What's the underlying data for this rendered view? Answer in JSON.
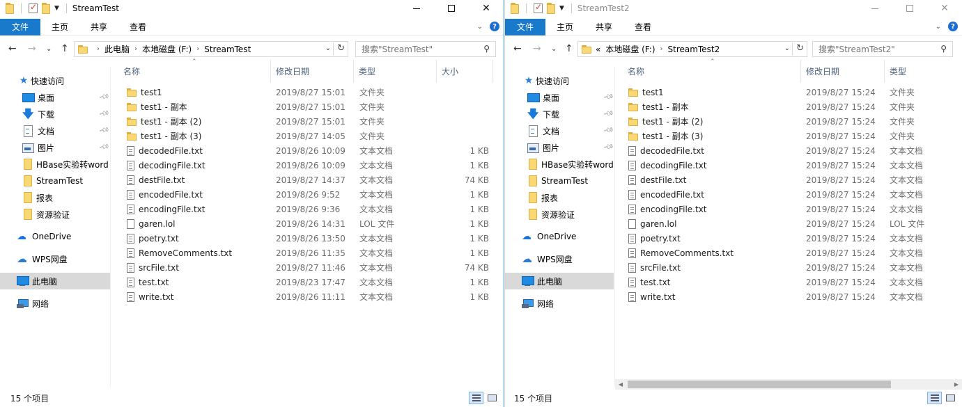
{
  "windows": [
    {
      "title": "StreamTest",
      "ribbon_tabs": [
        "文件",
        "主页",
        "共享",
        "查看"
      ],
      "breadcrumb": [
        "此电脑",
        "本地磁盘 (F:)",
        "StreamTest"
      ],
      "breadcrumb_prefix": "",
      "search_placeholder": "搜索\"StreamTest\"",
      "columns": [
        "名称",
        "修改日期",
        "类型",
        "大小"
      ],
      "status": "15 个项目",
      "files": [
        {
          "name": "test1",
          "date": "2019/8/27 15:01",
          "type": "文件夹",
          "size": "",
          "kind": "folder"
        },
        {
          "name": "test1 - 副本",
          "date": "2019/8/27 15:01",
          "type": "文件夹",
          "size": "",
          "kind": "folder"
        },
        {
          "name": "test1 - 副本 (2)",
          "date": "2019/8/27 15:01",
          "type": "文件夹",
          "size": "",
          "kind": "folder"
        },
        {
          "name": "test1 - 副本 (3)",
          "date": "2019/8/27 14:05",
          "type": "文件夹",
          "size": "",
          "kind": "folder"
        },
        {
          "name": "decodedFile.txt",
          "date": "2019/8/26 10:09",
          "type": "文本文档",
          "size": "1 KB",
          "kind": "txt"
        },
        {
          "name": "decodingFile.txt",
          "date": "2019/8/26 10:09",
          "type": "文本文档",
          "size": "1 KB",
          "kind": "txt"
        },
        {
          "name": "destFile.txt",
          "date": "2019/8/27 14:37",
          "type": "文本文档",
          "size": "74 KB",
          "kind": "txt"
        },
        {
          "name": "encodedFile.txt",
          "date": "2019/8/26 9:52",
          "type": "文本文档",
          "size": "1 KB",
          "kind": "txt"
        },
        {
          "name": "encodingFile.txt",
          "date": "2019/8/26 9:36",
          "type": "文本文档",
          "size": "1 KB",
          "kind": "txt"
        },
        {
          "name": "garen.lol",
          "date": "2019/8/26 14:31",
          "type": "LOL 文件",
          "size": "1 KB",
          "kind": "file"
        },
        {
          "name": "poetry.txt",
          "date": "2019/8/26 13:50",
          "type": "文本文档",
          "size": "1 KB",
          "kind": "txt"
        },
        {
          "name": "RemoveComments.txt",
          "date": "2019/8/26 11:35",
          "type": "文本文档",
          "size": "1 KB",
          "kind": "txt"
        },
        {
          "name": "srcFile.txt",
          "date": "2019/8/27 11:46",
          "type": "文本文档",
          "size": "74 KB",
          "kind": "txt"
        },
        {
          "name": "test.txt",
          "date": "2019/8/23 17:47",
          "type": "文本文档",
          "size": "1 KB",
          "kind": "txt"
        },
        {
          "name": "write.txt",
          "date": "2019/8/26 11:11",
          "type": "文本文档",
          "size": "1 KB",
          "kind": "txt"
        }
      ]
    },
    {
      "title": "StreamTest2",
      "ribbon_tabs": [
        "文件",
        "主页",
        "共享",
        "查看"
      ],
      "breadcrumb": [
        "本地磁盘 (F:)",
        "StreamTest2"
      ],
      "breadcrumb_prefix": "«",
      "search_placeholder": "搜索\"StreamTest2\"",
      "columns": [
        "名称",
        "修改日期",
        "类型"
      ],
      "status": "15 个项目",
      "files": [
        {
          "name": "test1",
          "date": "2019/8/27 15:24",
          "type": "文件夹",
          "kind": "folder"
        },
        {
          "name": "test1 - 副本",
          "date": "2019/8/27 15:24",
          "type": "文件夹",
          "kind": "folder"
        },
        {
          "name": "test1 - 副本 (2)",
          "date": "2019/8/27 15:24",
          "type": "文件夹",
          "kind": "folder"
        },
        {
          "name": "test1 - 副本 (3)",
          "date": "2019/8/27 15:24",
          "type": "文件夹",
          "kind": "folder"
        },
        {
          "name": "decodedFile.txt",
          "date": "2019/8/27 15:24",
          "type": "文本文档",
          "kind": "txt"
        },
        {
          "name": "decodingFile.txt",
          "date": "2019/8/27 15:24",
          "type": "文本文档",
          "kind": "txt"
        },
        {
          "name": "destFile.txt",
          "date": "2019/8/27 15:24",
          "type": "文本文档",
          "kind": "txt"
        },
        {
          "name": "encodedFile.txt",
          "date": "2019/8/27 15:24",
          "type": "文本文档",
          "kind": "txt"
        },
        {
          "name": "encodingFile.txt",
          "date": "2019/8/27 15:24",
          "type": "文本文档",
          "kind": "txt"
        },
        {
          "name": "garen.lol",
          "date": "2019/8/27 15:24",
          "type": "LOL 文件",
          "kind": "file"
        },
        {
          "name": "poetry.txt",
          "date": "2019/8/27 15:24",
          "type": "文本文档",
          "kind": "txt"
        },
        {
          "name": "RemoveComments.txt",
          "date": "2019/8/27 15:24",
          "type": "文本文档",
          "kind": "txt"
        },
        {
          "name": "srcFile.txt",
          "date": "2019/8/27 15:24",
          "type": "文本文档",
          "kind": "txt"
        },
        {
          "name": "test.txt",
          "date": "2019/8/27 15:24",
          "type": "文本文档",
          "kind": "txt"
        },
        {
          "name": "write.txt",
          "date": "2019/8/27 15:24",
          "type": "文本文档",
          "kind": "txt"
        }
      ]
    }
  ],
  "nav": {
    "quick_access": "快速访问",
    "items": [
      {
        "label": "桌面",
        "icon": "desktop-icon",
        "pinned": true
      },
      {
        "label": "下载",
        "icon": "download-icon",
        "pinned": true
      },
      {
        "label": "文档",
        "icon": "document-icon",
        "pinned": true
      },
      {
        "label": "图片",
        "icon": "picture-icon",
        "pinned": true
      },
      {
        "label": "HBase实验转word",
        "icon": "folder-icon",
        "pinned": false
      },
      {
        "label": "StreamTest",
        "icon": "folder-icon",
        "pinned": false
      },
      {
        "label": "报表",
        "icon": "folder-icon",
        "pinned": false
      },
      {
        "label": "资源验证",
        "icon": "folder-icon",
        "pinned": false
      }
    ],
    "onedrive": "OneDrive",
    "wps": "WPS网盘",
    "this_pc": "此电脑",
    "network": "网络"
  },
  "colors": {
    "accent": "#1979ca",
    "selected_nav": "#d9d9d9",
    "folder": "#f8d775"
  }
}
